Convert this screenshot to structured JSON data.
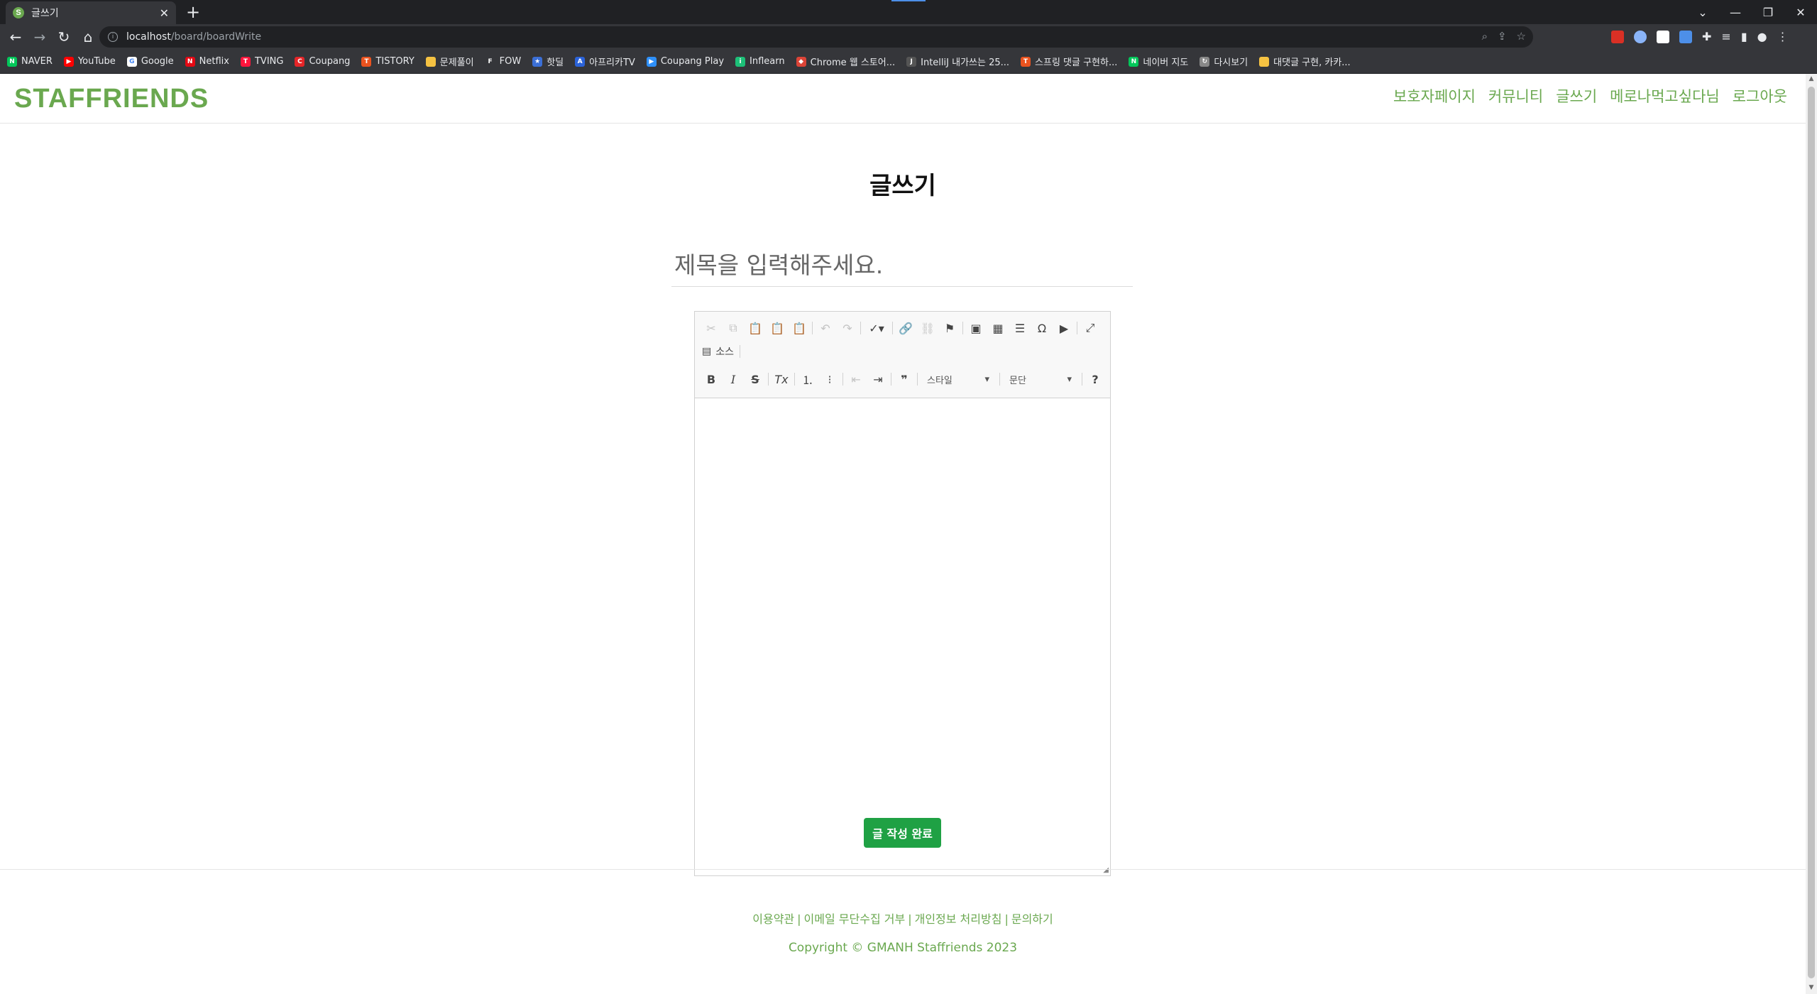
{
  "browser": {
    "tab_title": "글쓰기",
    "tab_favicon_letter": "S",
    "url_host": "localhost",
    "url_path": "/board/boardWrite",
    "bookmarks": [
      {
        "label": "NAVER",
        "color": "#03c75a",
        "glyph": "N"
      },
      {
        "label": "YouTube",
        "color": "#ff0000",
        "glyph": "▶"
      },
      {
        "label": "Google",
        "color": "#ffffff",
        "glyph": "G"
      },
      {
        "label": "Netflix",
        "color": "#e50914",
        "glyph": "N"
      },
      {
        "label": "TVING",
        "color": "#ff153c",
        "glyph": "T"
      },
      {
        "label": "Coupang",
        "color": "#e52528",
        "glyph": "C"
      },
      {
        "label": "TISTORY",
        "color": "#eb531f",
        "glyph": "T"
      },
      {
        "label": "문제풀이",
        "color": "#f5c242",
        "glyph": ""
      },
      {
        "label": "FOW",
        "color": "#35363a",
        "glyph": "F"
      },
      {
        "label": "핫딜",
        "color": "#3b6fd6",
        "glyph": "★"
      },
      {
        "label": "아프리카TV",
        "color": "#2b63d9",
        "glyph": "A"
      },
      {
        "label": "Coupang Play",
        "color": "#2e90fa",
        "glyph": "▶"
      },
      {
        "label": "Inflearn",
        "color": "#1dc078",
        "glyph": "i"
      },
      {
        "label": "Chrome 웹 스토어...",
        "color": "#db4437",
        "glyph": "◆"
      },
      {
        "label": "IntelliJ 내가쓰는 25...",
        "color": "#555555",
        "glyph": "J"
      },
      {
        "label": "스프링 댓글 구현하...",
        "color": "#eb531f",
        "glyph": "T"
      },
      {
        "label": "네이버 지도",
        "color": "#03c75a",
        "glyph": "N"
      },
      {
        "label": "다시보기",
        "color": "#888888",
        "glyph": "↻"
      },
      {
        "label": "대댓글 구현, 카카...",
        "color": "#f5c242",
        "glyph": ""
      }
    ]
  },
  "site": {
    "logo": "STAFFRIENDS",
    "nav": [
      "보호자페이지",
      "커뮤니티",
      "글쓰기",
      "메로나먹고싶다님",
      "로그아웃"
    ]
  },
  "write": {
    "heading": "글쓰기",
    "title_placeholder": "제목을 입력해주세요.",
    "editor": {
      "source_label": "소스",
      "style_combo": "스타일",
      "format_combo": "문단"
    },
    "submit_label": "글 작성 완료"
  },
  "footer": {
    "links": [
      "이용약관",
      "이메일 무단수집 거부",
      "개인정보 처리방침",
      "문의하기"
    ],
    "copyright": "Copyright © GMANH Staffriends 2023"
  },
  "colors": {
    "brand_green": "#6aa84f",
    "submit_green": "#1fa144"
  }
}
